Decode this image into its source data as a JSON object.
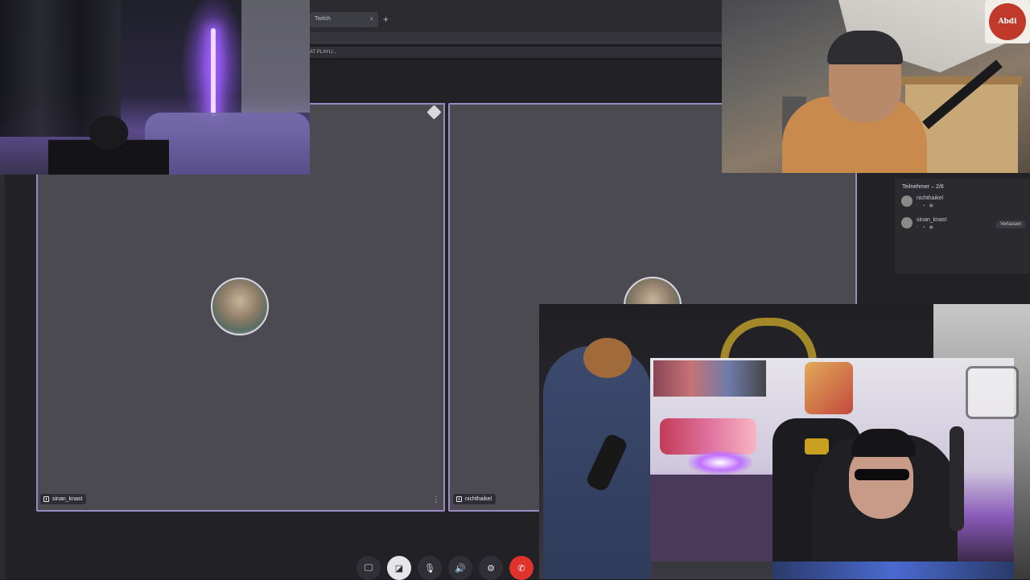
{
  "browser": {
    "tab_label": "Twitch",
    "tab_close": "×",
    "new_tab": "+",
    "bookmark_text": "AT PLAYLI..."
  },
  "call": {
    "tiles": [
      {
        "name": "sinan_knast",
        "menu": "⋮"
      },
      {
        "name": "nichthaikel"
      }
    ]
  },
  "participants": {
    "title": "Teilnehmer – 2/6",
    "items": [
      {
        "name": "nichthaikel",
        "icons": "◦ ▪ ◉"
      },
      {
        "name": "sinan_knast",
        "icons": "◦ ▪ ◉"
      }
    ],
    "button_label": "Verlassen"
  },
  "controls": {
    "screen_icon": "🖵",
    "camera_icon": "◪",
    "mic_icon": "🎙",
    "speaker_icon": "🔊",
    "settings_icon": "⚙",
    "hangup_icon": "✆"
  },
  "overlays": {
    "logo_text": "Abdi"
  },
  "colors": {
    "tile_border": "#9b8ac2",
    "hangup": "#e0332b"
  }
}
